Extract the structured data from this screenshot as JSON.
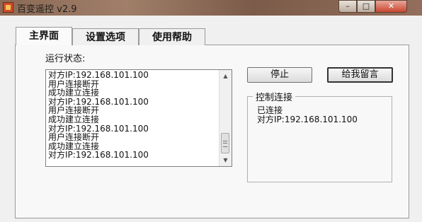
{
  "window": {
    "title": "百变遥控 v2.9",
    "controls": {
      "minimize": "–",
      "maximize": "□",
      "close": "✕"
    }
  },
  "tabs": [
    {
      "label": "主界面",
      "active": true
    },
    {
      "label": "设置选项",
      "active": false
    },
    {
      "label": "使用帮助",
      "active": false
    }
  ],
  "main": {
    "status_label": "运行状态:",
    "log": [
      "对方IP:192.168.101.100",
      "用户连接断开",
      "成功建立连接",
      "对方IP:192.168.101.100",
      "用户连接断开",
      "成功建立连接",
      "对方IP:192.168.101.100",
      "用户连接断开",
      "成功建立连接",
      "对方IP:192.168.101.100"
    ],
    "buttons": {
      "stop": "停止",
      "leave_message": "给我留言"
    },
    "control_group": {
      "title": "控制连接",
      "status": "已连接",
      "peer_ip": "对方IP:192.168.101.100"
    }
  }
}
